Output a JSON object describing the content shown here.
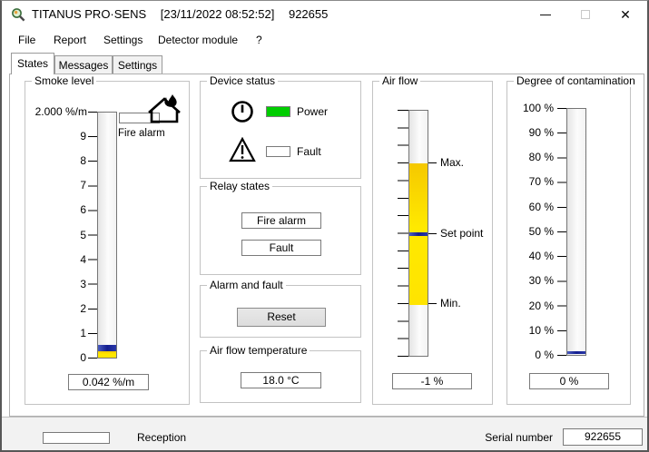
{
  "window": {
    "app_name": "TITANUS PRO·SENS",
    "datetime": "[23/11/2022 08:52:52]",
    "device_id": "922655",
    "close_glyph": "✕"
  },
  "menu": {
    "items": [
      "File",
      "Report",
      "Settings",
      "Detector module",
      "?"
    ]
  },
  "tabs": {
    "states": "States",
    "messages": "Messages",
    "settings": "Settings"
  },
  "smoke_level": {
    "title": "Smoke level",
    "scale_top_label": "2.000 %/m",
    "scale_ticks": [
      "9",
      "8",
      "7",
      "6",
      "5",
      "4",
      "3",
      "2",
      "1",
      "0"
    ],
    "fire_alarm_label": "Fire alarm",
    "value": "0.042 %/m",
    "bar_color": "#ffe400",
    "marker_color": "#141f8f"
  },
  "device_status": {
    "title": "Device status",
    "power_label": "Power",
    "power_state_color": "#00cd00",
    "fault_label": "Fault",
    "fault_state_color": "#ffffff"
  },
  "relay_states": {
    "title": "Relay states",
    "fire_alarm_label": "Fire alarm",
    "fault_label": "Fault"
  },
  "alarm_fault": {
    "title": "Alarm and fault",
    "reset_label": "Reset"
  },
  "air_temp": {
    "title": "Air flow temperature",
    "value": "18.0 °C"
  },
  "air_flow": {
    "title": "Air flow",
    "max_label": "Max.",
    "set_point_label": "Set point",
    "min_label": "Min.",
    "value": "-1 %",
    "band_color": "#ffe400",
    "set_point_color": "#141f8f"
  },
  "contamination": {
    "title": "Degree of contamination",
    "scale_ticks": [
      "100 %",
      "90 %",
      "80 %",
      "70 %",
      "60 %",
      "50 %",
      "40 %",
      "30 %",
      "20 %",
      "10 %",
      "0 %"
    ],
    "value": "0 %",
    "marker_color": "#141f8f"
  },
  "status_bar": {
    "reception_label": "Reception",
    "serial_label": "Serial number",
    "serial_value": "922655"
  }
}
